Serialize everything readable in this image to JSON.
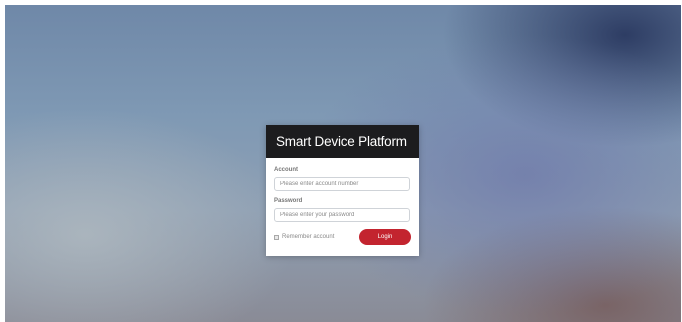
{
  "colors": {
    "header_bg": "#1c1c1e",
    "primary_button": "#c3242f",
    "card_bg": "#ffffff"
  },
  "login": {
    "title": "Smart Device Platform",
    "account": {
      "label": "Account",
      "placeholder": "Please enter account number",
      "value": ""
    },
    "password": {
      "label": "Password",
      "placeholder": "Please enter your password",
      "value": ""
    },
    "remember_label": "Remember account",
    "remember_checked": false,
    "login_label": "Login"
  }
}
